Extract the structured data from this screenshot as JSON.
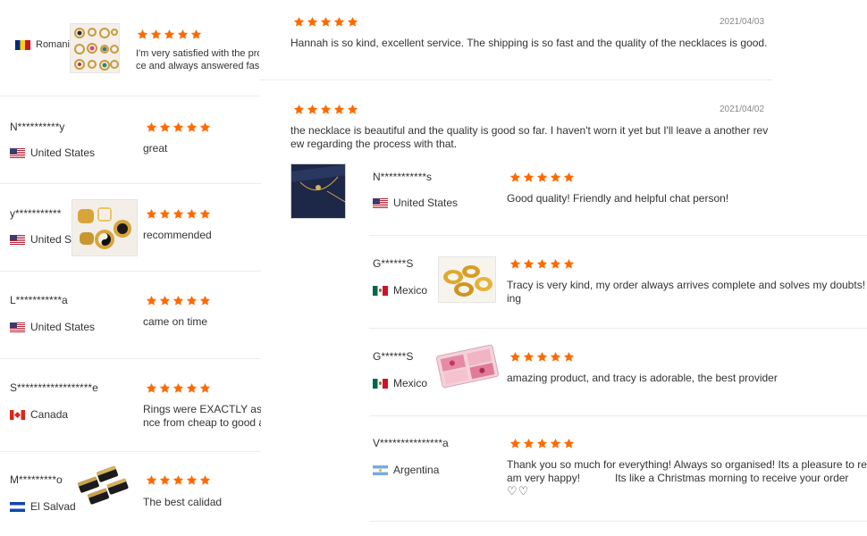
{
  "left_column": {
    "reviews": [
      {
        "user": "Romania",
        "country": "",
        "flag": "ro",
        "text_lines": [
          "I'm very satisfied with the proc",
          "ce and always answered fast,"
        ],
        "photo": "earrings-grid"
      },
      {
        "user": "N**********y",
        "country": "United States",
        "flag": "us",
        "text_lines": [
          "great"
        ]
      },
      {
        "user": "y***********",
        "country": "United St",
        "flag": "us",
        "text_lines": [
          "recommended"
        ],
        "photo": "gold-rings"
      },
      {
        "user": "L***********a",
        "country": "United States",
        "flag": "us",
        "text_lines": [
          "came on time"
        ]
      },
      {
        "user": "S******************e",
        "country": "Canada",
        "flag": "ca",
        "text_lines": [
          "Rings were EXACTLY as described, they are BEAU",
          "nce from cheap to good and these are EXCELLEN"
        ]
      },
      {
        "user": "M*********o",
        "country": "El Salvado",
        "flag": "sv",
        "text_lines": [
          "The best calidad"
        ],
        "photo": "black-gold-rings"
      }
    ]
  },
  "middle_column": {
    "reviews": [
      {
        "date": "2021/04/03",
        "text_lines": [
          "Hannah is so kind, excellent service. The shipping is so fast and the quality of the necklaces is good."
        ]
      },
      {
        "date": "2021/04/02",
        "text_lines": [
          "the necklace is beautiful and the quality is good so far. I haven't worn it yet but I'll leave a another revi",
          "ew regarding the process with that."
        ],
        "photo": "necklace-navy"
      }
    ]
  },
  "right_column": {
    "reviews": [
      {
        "user": "N***********s",
        "country": "United States",
        "flag": "us",
        "text_lines": [
          "Good quality! Friendly and helpful chat person!"
        ]
      },
      {
        "user": "G******S",
        "country": "Mexico",
        "flag": "mx",
        "text_lines": [
          "Tracy is very kind, my order always arrives complete and solves my doubts! th",
          "ing"
        ],
        "photo": "gold-rings-white"
      },
      {
        "user": "G******S",
        "country": "Mexico",
        "flag": "mx",
        "text_lines": [
          "amazing product, and tracy is adorable, the best provider"
        ],
        "photo": "pink-box"
      },
      {
        "user": "V***************a",
        "country": "Argentina",
        "flag": "ar",
        "text_lines": [
          "Thank you so much for everything! Always so organised! Its a pleasure to rece",
          "am very happy!"
        ],
        "extra_text": "Its like a Christmas morning to receive your order",
        "hearts": "♡♡"
      }
    ]
  },
  "colors": {
    "star": "#ff6a00",
    "divider": "#ececec",
    "text": "#333333",
    "date": "#888888"
  },
  "rating_icon": "star-icon"
}
